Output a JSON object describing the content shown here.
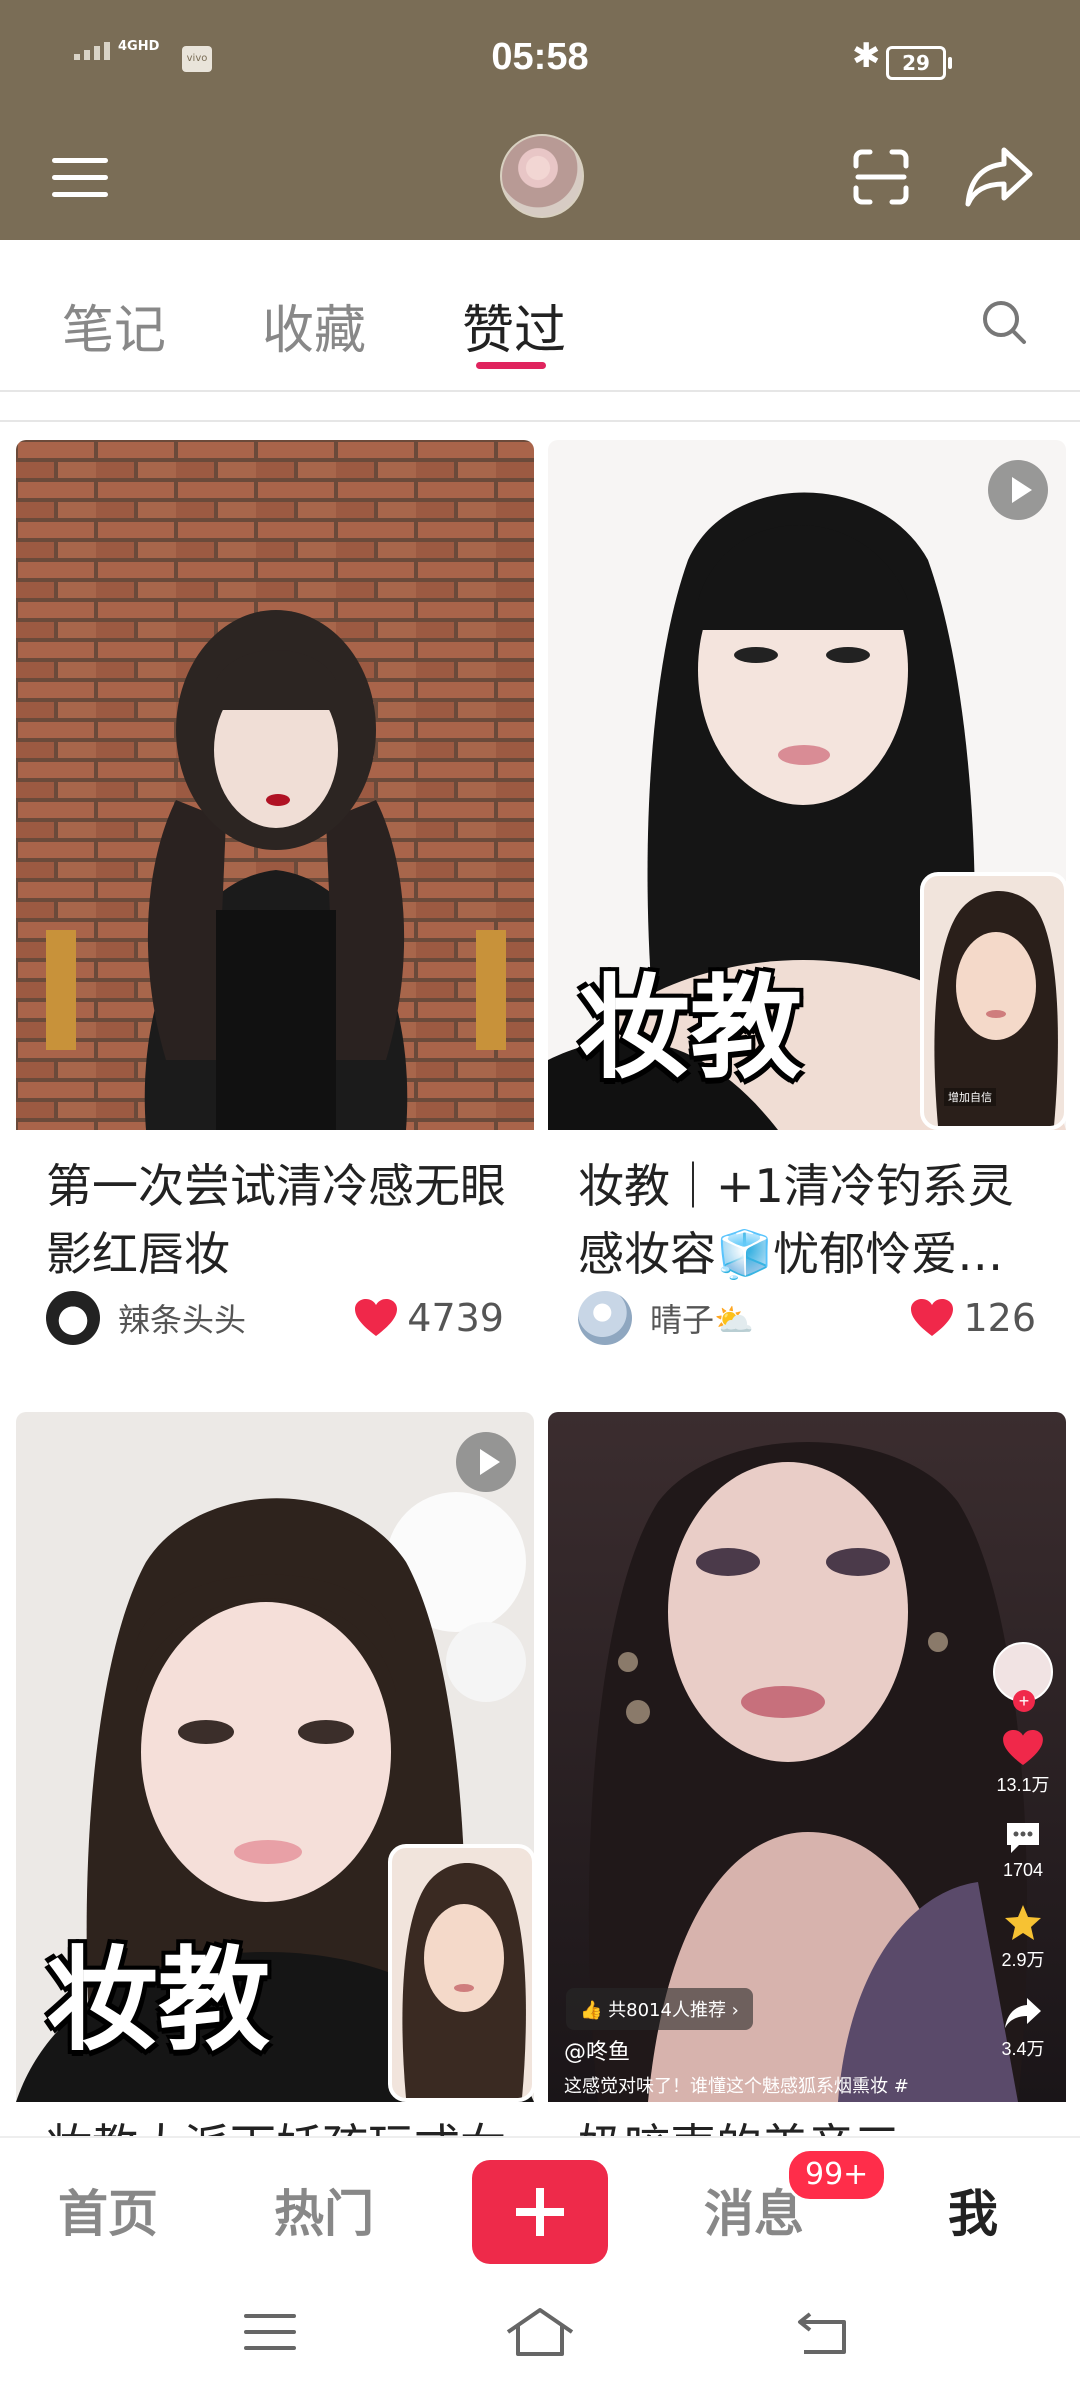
{
  "status_bar": {
    "time": "05:58",
    "network": "4GHD",
    "carrier_logo": "vivo",
    "battery": "29"
  },
  "tabs": [
    {
      "label": "笔记"
    },
    {
      "label": "收藏"
    },
    {
      "label": "赞过"
    }
  ],
  "cards": [
    {
      "title": "第一次尝试清冷感无眼影红唇妆",
      "author": "辣条头头",
      "likes": "4739"
    },
    {
      "title": "妆教｜+1清冷钓系灵感妆容🧊忧郁怜爱…",
      "author": "晴子⛅",
      "likes": "126",
      "overlay": "妆教",
      "inset_caption": "增加自信"
    },
    {
      "title": "妆教大派下妖孩玩式女",
      "overlay": "妆教"
    },
    {
      "title": "奶咬声的美音三",
      "video_recommend": "共8014人推荐",
      "video_author": "@咚鱼",
      "video_desc": "这感觉对味了！谁懂这个魅感狐系烟熏妆 #",
      "video_stats": {
        "likes": "13.1万",
        "comments": "1704",
        "favorites": "2.9万",
        "shares": "3.4万"
      }
    }
  ],
  "bottom_nav": {
    "home": "首页",
    "hot": "热门",
    "messages": "消息",
    "badge": "99+",
    "me": "我"
  },
  "colors": {
    "accent": "#e0245e",
    "header_bg": "#7a6d56",
    "post_button": "#ee2a4a"
  }
}
